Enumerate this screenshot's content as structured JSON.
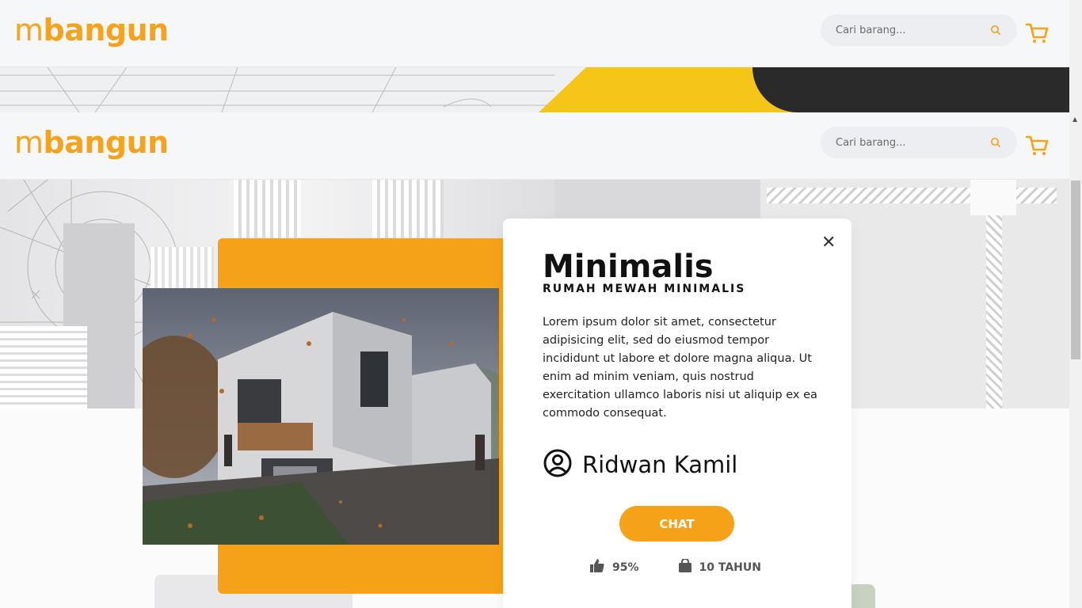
{
  "brand": {
    "logo_m": "m",
    "logo_rest": "bangun",
    "color": "#f6a21a"
  },
  "search": {
    "placeholder": "Cari barang..."
  },
  "icons": {
    "search": "search-icon",
    "cart": "cart-icon",
    "close": "close-icon",
    "user": "user-circle-icon",
    "like": "thumbs-up-icon",
    "bag": "shopping-bag-icon"
  },
  "modal": {
    "title": "Minimalis",
    "subtitle": "RUMAH MEWAH MINIMALIS",
    "description": "Lorem ipsum dolor sit amet, consectetur adipisicing elit, sed do eiusmod tempor incididunt ut labore et dolore magna aliqua. Ut enim ad minim veniam, quis nostrud exercitation ullamco laboris nisi ut aliquip ex ea commodo consequat.",
    "author": "Ridwan Kamil",
    "chat_label": "CHAT",
    "stat_rating": "95%",
    "stat_experience": "10 TAHUN",
    "close_glyph": "✕"
  },
  "colors": {
    "accent": "#f6a219",
    "text": "#111111"
  }
}
